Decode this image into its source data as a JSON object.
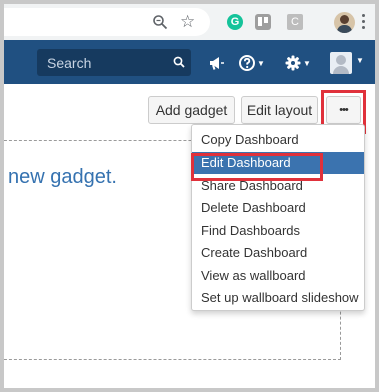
{
  "browser": {
    "extensions": [
      "grammarly-icon",
      "trello-icon",
      "c-extension-icon"
    ],
    "grammarly_letter": "G",
    "c_letter": "C"
  },
  "header": {
    "search_placeholder": "Search",
    "background": "#205081"
  },
  "toolbar": {
    "add_gadget": "Add gadget",
    "edit_layout": "Edit layout",
    "more": "•••"
  },
  "gadget_area": {
    "text": "new gadget."
  },
  "menu": {
    "items": [
      "Copy Dashboard",
      "Edit Dashboard",
      "Share Dashboard",
      "Delete Dashboard",
      "Find Dashboards",
      "Create Dashboard",
      "View as wallboard",
      "Set up wallboard slideshow"
    ],
    "selected": "Edit Dashboard",
    "highlight_color": "#3b73af"
  },
  "annotation_color": "#e0313b"
}
